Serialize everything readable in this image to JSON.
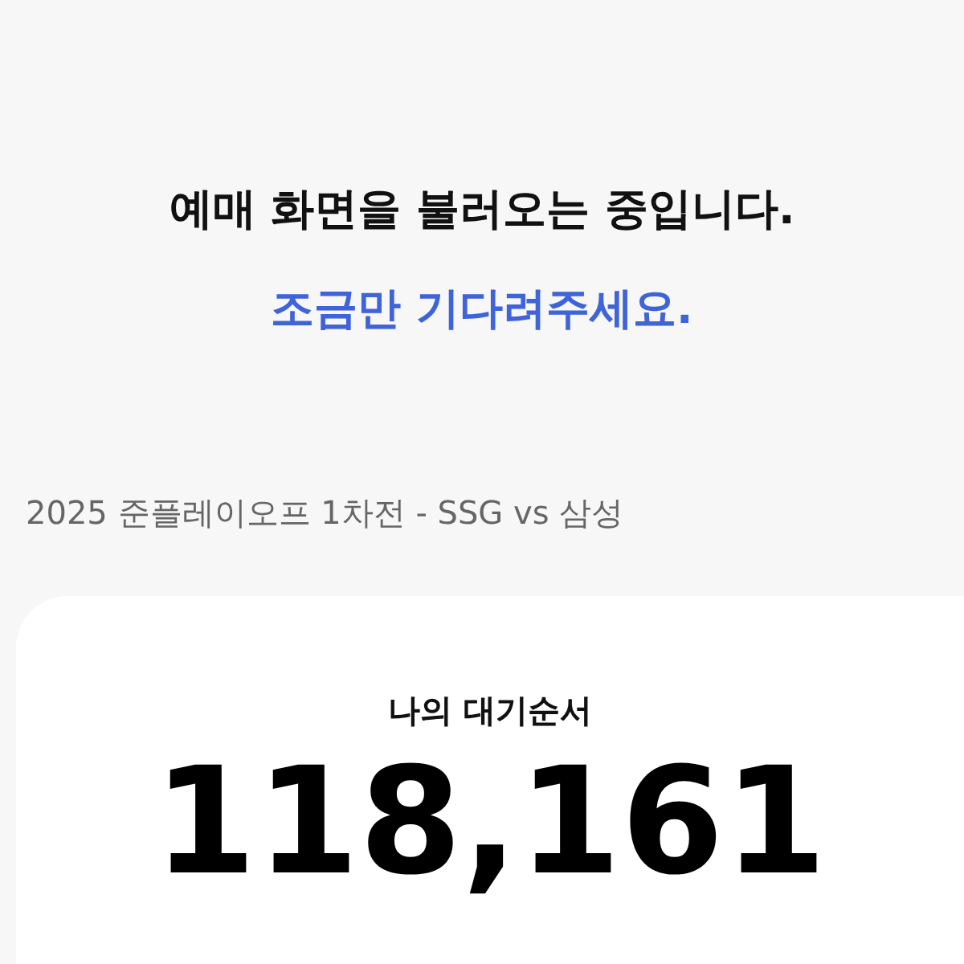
{
  "loading": {
    "title": "예매 화면을 불러오는 중입니다.",
    "subtitle": "조금만 기다려주세요."
  },
  "game_title": "2025 준플레이오프 1차전 - SSG vs 삼성",
  "queue_card": {
    "label": "나의 대기순서",
    "number": "118,161"
  }
}
